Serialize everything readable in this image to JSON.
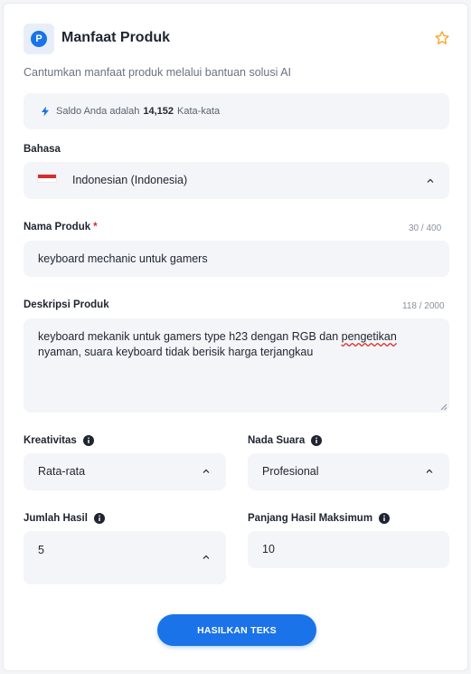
{
  "header": {
    "logo_letter": "P",
    "title": "Manfaat Produk",
    "subtitle": "Cantumkan manfaat produk melalui bantuan solusi AI",
    "favorite_icon": "star-outline-icon"
  },
  "balance": {
    "prefix": "Saldo Anda adalah",
    "amount": "14,152",
    "suffix": "Kata-kata",
    "icon": "lightning-icon"
  },
  "language": {
    "label": "Bahasa",
    "value": "Indonesian (Indonesia)",
    "flag": "indonesia-flag"
  },
  "product_name": {
    "label": "Nama Produk",
    "required_mark": "*",
    "counter": "30 / 400",
    "value": "keyboard mechanic untuk gamers"
  },
  "product_description": {
    "label": "Deskripsi Produk",
    "counter": "118 / 2000",
    "value_before": "keyboard mekanik untuk gamers type h23 dengan RGB dan ",
    "value_misspelled": "pengetikan",
    "value_after": " nyaman, suara keyboard tidak berisik harga terjangkau"
  },
  "creativity": {
    "label": "Kreativitas",
    "value": "Rata-rata"
  },
  "tone": {
    "label": "Nada Suara",
    "value": "Profesional"
  },
  "result_count": {
    "label": "Jumlah Hasil",
    "value": "5"
  },
  "max_length": {
    "label": "Panjang Hasil Maksimum",
    "value": "10"
  },
  "submit": {
    "label": "HASILKAN TEKS"
  },
  "colors": {
    "accent": "#1a73e8",
    "required": "#e02424",
    "star": "#f5a623",
    "field_bg": "#f3f5f8"
  }
}
